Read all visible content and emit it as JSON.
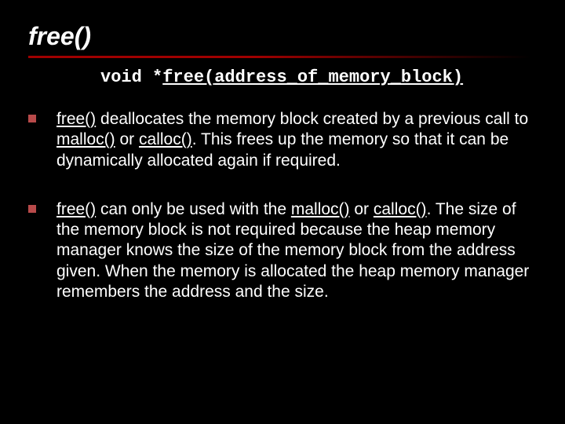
{
  "title": "free()",
  "prototype": {
    "parts": [
      {
        "t": "void *",
        "u": false
      },
      {
        "t": "free(",
        "u": true
      },
      {
        "t": "address_of_memory_block",
        "u": true
      },
      {
        "t": ")",
        "u": true
      }
    ]
  },
  "bullets": [
    {
      "runs": [
        {
          "t": "free()",
          "u": true
        },
        {
          "t": " deallocates the memory block created by a previous call to ",
          "u": false
        },
        {
          "t": "malloc()",
          "u": true
        },
        {
          "t": " or ",
          "u": false
        },
        {
          "t": "calloc()",
          "u": true
        },
        {
          "t": ". This frees up the memory so that it can be dynamically allocated again if required.",
          "u": false
        }
      ]
    },
    {
      "runs": [
        {
          "t": "free()",
          "u": true
        },
        {
          "t": " can only be used with the ",
          "u": false
        },
        {
          "t": "malloc()",
          "u": true
        },
        {
          "t": " or ",
          "u": false
        },
        {
          "t": "calloc()",
          "u": true
        },
        {
          "t": ". The size of the memory block is not required because the heap memory manager knows the size of the memory block from the address given. When the memory is allocated the heap memory manager remembers the address and the size.",
          "u": false
        }
      ]
    }
  ]
}
